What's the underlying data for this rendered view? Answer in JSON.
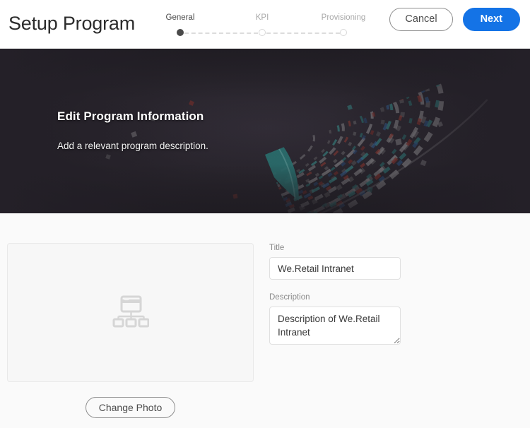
{
  "header": {
    "app_title": "Setup Program",
    "steps": [
      {
        "label": "General",
        "state": "active"
      },
      {
        "label": "KPI",
        "state": "inactive"
      },
      {
        "label": "Provisioning",
        "state": "inactive"
      }
    ],
    "cancel_label": "Cancel",
    "next_label": "Next"
  },
  "hero": {
    "title": "Edit Program Information",
    "subtitle": "Add a relevant program description.",
    "background_color": "#2a262e",
    "art_colors": {
      "teal": "#3aa9a4",
      "red": "#c0392b",
      "blue": "#2b6cb0",
      "gold": "#c8a020",
      "gray": "#b8b8b8"
    }
  },
  "content": {
    "photo": {
      "placeholder_icon": "sitemap-icon",
      "change_photo_label": "Change Photo"
    },
    "form": {
      "title_label": "Title",
      "title_value": "We.Retail Intranet",
      "title_placeholder": "",
      "description_label": "Description",
      "description_value": "Description of We.Retail Intranet",
      "description_placeholder": ""
    }
  },
  "theme": {
    "accent": "#1473e6",
    "page_background": "#fafafa",
    "border": "#e0e0e0",
    "muted_text": "#8a8a8a"
  }
}
